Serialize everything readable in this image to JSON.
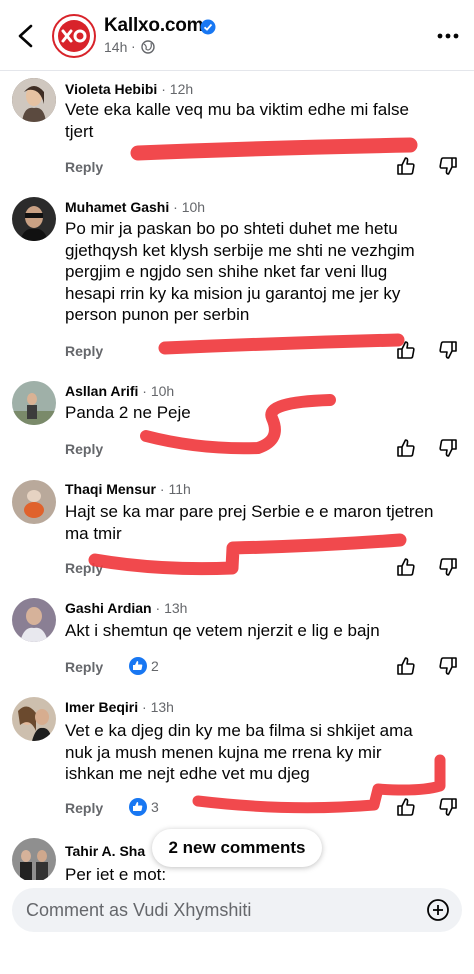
{
  "header": {
    "page_name": "Kallxo.com",
    "post_time": "14h",
    "brand_color": "#d8232a"
  },
  "comments": [
    {
      "name": "Violeta Hebibi",
      "time": "12h",
      "lines": [
        "Vete eka kalle veq mu ba viktim edhe mi false",
        "tjert"
      ],
      "reply": "Reply"
    },
    {
      "name": "Muhamet Gashi",
      "time": "10h",
      "lines": [
        "Po mir ja paskan bo po shteti duhet me hetu",
        "gjethqysh ket klysh serbije me shti ne vezhgim",
        "pergjim e ngjdo sen  shihe nket far veni llug",
        "hesapi rrin ky ka mision ju garantoj me jer ky",
        "person punon per serbin"
      ],
      "reply": "Reply"
    },
    {
      "name": "Asllan Arifi",
      "time": "10h",
      "lines": [
        "Panda 2 ne Peje"
      ],
      "reply": "Reply"
    },
    {
      "name": "Thaqi Mensur",
      "time": "11h",
      "lines": [
        "Hajt se ka mar pare prej Serbie e e maron tjetren",
        "ma tmir"
      ],
      "reply": "Reply"
    },
    {
      "name": "Gashi Ardian",
      "time": "13h",
      "lines": [
        "Akt i shemtun qe vetem njerzit e lig e bajn"
      ],
      "reply": "Reply",
      "reactions": "2"
    },
    {
      "name": "Imer Beqiri",
      "time": "13h",
      "lines": [
        "Vet e  ka djeg  din ky me ba filma si shkijet   ama",
        "nuk ja mush menen kujna me rrena  ky mir",
        "ishkan me nejt edhe vet mu djeg"
      ],
      "reply": "Reply",
      "reactions": "3"
    },
    {
      "name": "Tahir A. Sha",
      "time": "",
      "lines": [
        "Per iet e mot:"
      ],
      "reply": ""
    }
  ],
  "new_comments_label": "2 new comments",
  "comment_placeholder": "Comment as Vudi Xhymshiti",
  "icons": [
    "back-arrow-icon",
    "verified-badge-icon",
    "globe-icon",
    "more-icon",
    "like-icon",
    "dislike-icon",
    "plus-circle-icon"
  ],
  "colors": {
    "scribble": "#f0393e",
    "verified": "#1877f2",
    "meta": "#65676b"
  }
}
